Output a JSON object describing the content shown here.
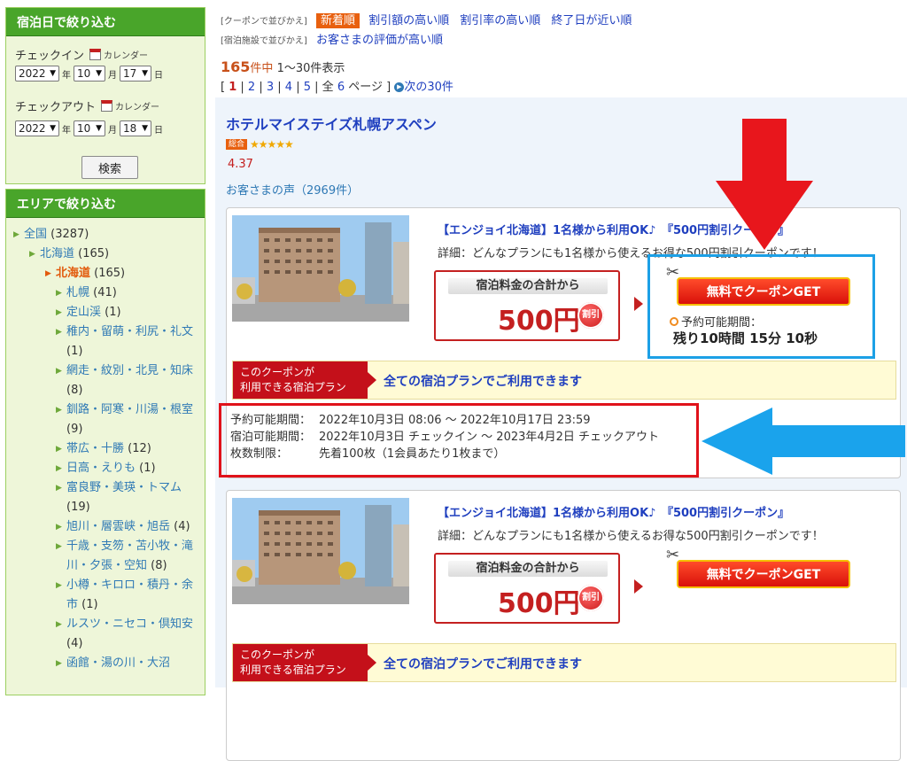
{
  "sidebar": {
    "date_filter": {
      "heading": "宿泊日で絞り込む",
      "checkin_label": "チェックイン",
      "checkout_label": "チェックアウト",
      "calendar_label": "カレンダー",
      "year_unit": "年",
      "month_unit": "月",
      "day_unit": "日",
      "checkin": {
        "year": "2022",
        "month": "10",
        "day": "17"
      },
      "checkout": {
        "year": "2022",
        "month": "10",
        "day": "18"
      },
      "search_button": "検索"
    },
    "area_filter": {
      "heading": "エリアで絞り込む",
      "items": [
        {
          "label": "全国",
          "count": "(3287)",
          "level": 0,
          "current": false
        },
        {
          "label": "北海道",
          "count": "(165)",
          "level": 1,
          "current": false
        },
        {
          "label": "北海道",
          "count": "(165)",
          "level": 2,
          "current": true
        },
        {
          "label": "札幌",
          "count": "(41)",
          "level": 3,
          "current": false
        },
        {
          "label": "定山渓",
          "count": "(1)",
          "level": 3,
          "current": false
        },
        {
          "label": "稚内・留萌・利尻・礼文",
          "count": "(1)",
          "level": 3,
          "current": false
        },
        {
          "label": "網走・紋別・北見・知床",
          "count": "(8)",
          "level": 3,
          "current": false
        },
        {
          "label": "釧路・阿寒・川湯・根室",
          "count": "(9)",
          "level": 3,
          "current": false
        },
        {
          "label": "帯広・十勝",
          "count": "(12)",
          "level": 3,
          "current": false
        },
        {
          "label": "日高・えりも",
          "count": "(1)",
          "level": 3,
          "current": false
        },
        {
          "label": "富良野・美瑛・トマム",
          "count": "(19)",
          "level": 3,
          "current": false
        },
        {
          "label": "旭川・層雲峡・旭岳",
          "count": "(4)",
          "level": 3,
          "current": false
        },
        {
          "label": "千歳・支笏・苫小牧・滝川・夕張・空知",
          "count": "(8)",
          "level": 3,
          "current": false
        },
        {
          "label": "小樽・キロロ・積丹・余市",
          "count": "(1)",
          "level": 3,
          "current": false
        },
        {
          "label": "ルスツ・ニセコ・倶知安",
          "count": "(4)",
          "level": 3,
          "current": false
        },
        {
          "label": "函館・湯の川・大沼",
          "count": "",
          "level": 3,
          "current": false
        }
      ]
    }
  },
  "sort": {
    "coupon_sort_label": "[クーポンで並びかえ]",
    "coupon_active": "新着順",
    "coupon_options": [
      "割引額の高い順",
      "割引率の高い順",
      "終了日が近い順"
    ],
    "facility_sort_label": "[宿泊施設で並びかえ]",
    "facility_options": [
      "お客さまの評価が高い順"
    ]
  },
  "results": {
    "total": "165",
    "total_unit": "件中",
    "range": "1〜30件表示",
    "pages": [
      "1",
      "2",
      "3",
      "4",
      "5"
    ],
    "current_page": "1",
    "page_total_prefix": "全",
    "page_total": "6",
    "page_total_suffix": "ページ",
    "next_label": "次の30件"
  },
  "hotel": {
    "name": "ホテルマイステイズ札幌アスペン",
    "rating_badge": "総合",
    "rating_value": 4.37,
    "rating_text": "4.37",
    "review_link": "お客さまの声（2969件）"
  },
  "coupons": [
    {
      "title": "【エンジョイ北海道】1名様から利用OK♪　『500円割引クーポン』",
      "desc": "詳細：どんなプランにも1名様から使えるお得な500円割引クーポンです！",
      "price_label": "宿泊料金の合計から",
      "price": "500円",
      "seal": "割引",
      "get_button": "無料でクーポンGET",
      "avail_label": "予約可能期間：",
      "remaining": "残り10時間 15分 10秒",
      "cond_tag_line1": "このクーポンが",
      "cond_tag_line2": "利用できる宿泊プラン",
      "cond_text": "全ての宿泊プランでご利用できます",
      "periods": [
        {
          "label": "予約可能期間：",
          "value": "2022年10月3日 08:06 〜 2022年10月17日 23:59"
        },
        {
          "label": "宿泊可能期間：",
          "value": "2022年10月3日 チェックイン 〜 2023年4月2日 チェックアウト"
        },
        {
          "label": "枚数制限：",
          "value": "先着100枚（1会員あたり1枚まで）"
        }
      ]
    },
    {
      "title": "【エンジョイ北海道】1名様から利用OK♪　『500円割引クーポン』",
      "desc": "詳細：どんなプランにも1名様から使えるお得な500円割引クーポンです！",
      "price_label": "宿泊料金の合計から",
      "price": "500円",
      "seal": "割引",
      "get_button": "無料でクーポンGET",
      "cond_tag_line1": "このクーポンが",
      "cond_tag_line2": "利用できる宿泊プラン",
      "cond_text": "全ての宿泊プランでご利用できます"
    }
  ],
  "colors": {
    "sidebar_header": "#49a52a",
    "link": "#1f3fbf",
    "accent_orange": "#e8600f",
    "price_red": "#c42020",
    "annotation_blue": "#1ca0e6",
    "annotation_red": "#e0121a"
  }
}
